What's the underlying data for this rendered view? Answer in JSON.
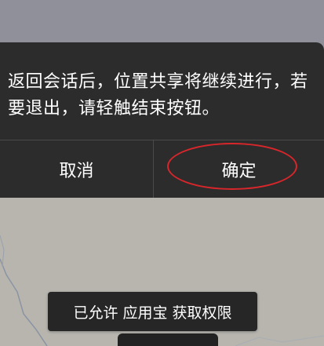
{
  "dialog": {
    "message": "返回会话后，位置共享将继续进行，若要退出，请轻触结束按钮。",
    "cancel_label": "取消",
    "confirm_label": "确定"
  },
  "toast": {
    "text": "已允许 应用宝 获取权限"
  },
  "colors": {
    "dialog_bg": "#2c2c2c",
    "map_bg": "#b7b5ae",
    "highlight_ellipse": "#d8262b"
  }
}
